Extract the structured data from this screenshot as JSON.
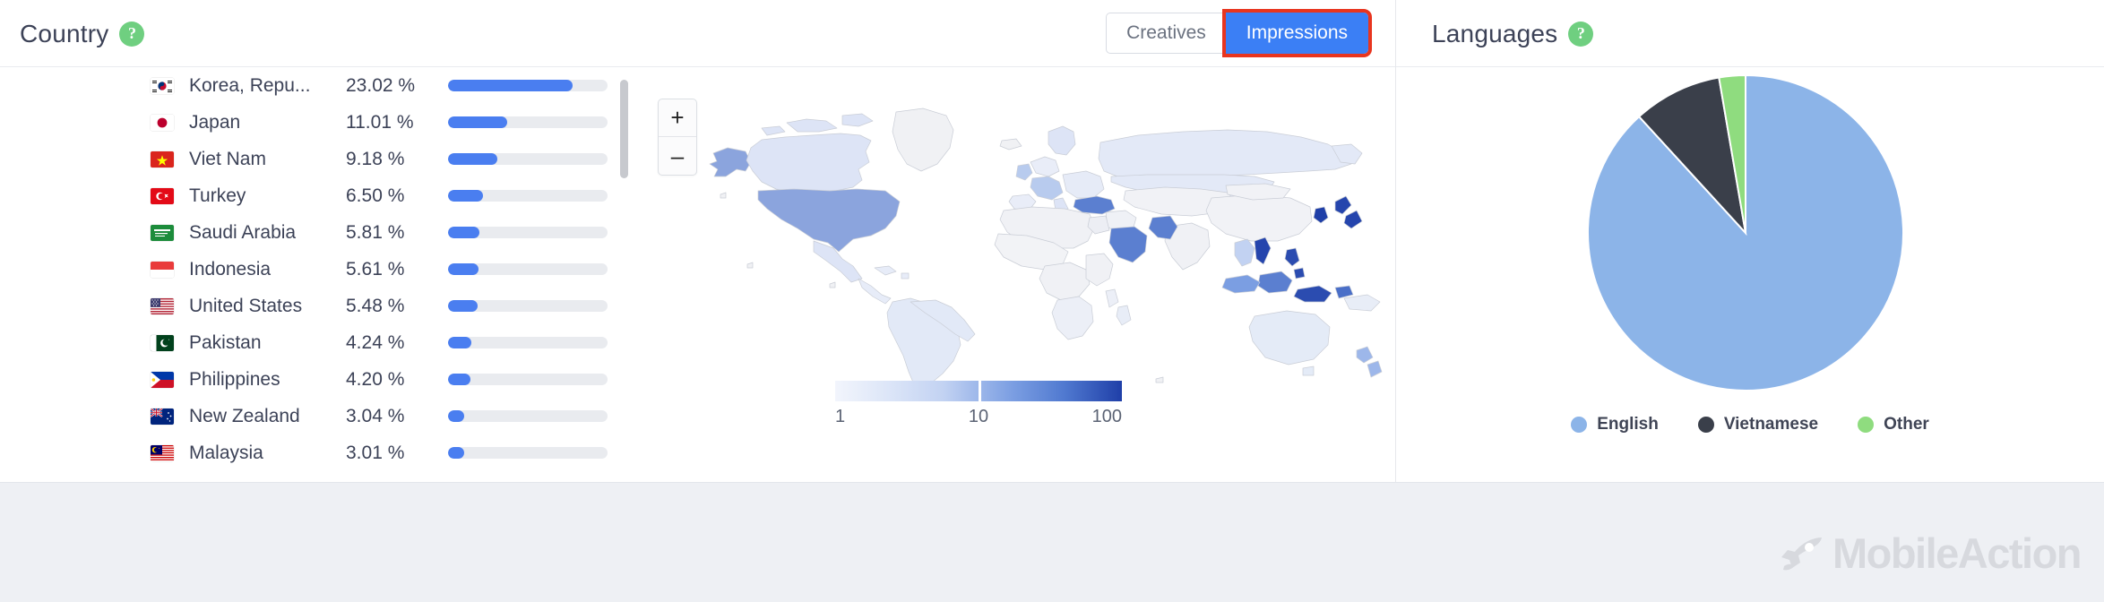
{
  "country_panel": {
    "title": "Country",
    "help_icon": "question-mark-icon",
    "help_label": "?",
    "toggle": {
      "options": [
        {
          "label": "Creatives",
          "active": false
        },
        {
          "label": "Impressions",
          "active": true
        }
      ],
      "selected": "Impressions",
      "active_color": "#3b7ff5",
      "highlight_color": "#e8351f"
    },
    "rows": [
      {
        "country": "Korea, Repu...",
        "percent": "23.02 %",
        "value": 23.02,
        "flag": "flag-kr"
      },
      {
        "country": "Japan",
        "percent": "11.01 %",
        "value": 11.01,
        "flag": "flag-jp"
      },
      {
        "country": "Viet Nam",
        "percent": "9.18 %",
        "value": 9.18,
        "flag": "flag-vn"
      },
      {
        "country": "Turkey",
        "percent": "6.50 %",
        "value": 6.5,
        "flag": "flag-tr"
      },
      {
        "country": "Saudi Arabia",
        "percent": "5.81 %",
        "value": 5.81,
        "flag": "flag-sa"
      },
      {
        "country": "Indonesia",
        "percent": "5.61 %",
        "value": 5.61,
        "flag": "flag-id"
      },
      {
        "country": "United States",
        "percent": "5.48 %",
        "value": 5.48,
        "flag": "flag-us"
      },
      {
        "country": "Pakistan",
        "percent": "4.24 %",
        "value": 4.24,
        "flag": "flag-pk"
      },
      {
        "country": "Philippines",
        "percent": "4.20 %",
        "value": 4.2,
        "flag": "flag-ph"
      },
      {
        "country": "New Zealand",
        "percent": "3.04 %",
        "value": 3.04,
        "flag": "flag-nz"
      },
      {
        "country": "Malaysia",
        "percent": "3.01 %",
        "value": 3.01,
        "flag": "flag-my"
      }
    ],
    "map": {
      "zoom_in_label": "+",
      "zoom_out_label": "–",
      "legend_ticks": [
        "1",
        "10",
        "100"
      ],
      "scale_low_color": "#f2f5fc",
      "scale_high_color": "#1f3fa8"
    }
  },
  "languages_panel": {
    "title": "Languages",
    "help_label": "?"
  },
  "chart_data": {
    "type": "pie",
    "title": "Languages",
    "labels": [
      "English",
      "Vietnamese",
      "Other"
    ],
    "values": [
      88.2,
      9.1,
      2.7
    ],
    "colors": [
      "#8cb4e8",
      "#3a3f4a",
      "#8fdc7f"
    ],
    "legend_position": "bottom",
    "grid": false
  },
  "footer": {
    "brand": "MobileAction",
    "brand_icon": "rocket-icon",
    "brand_color": "#d7d9de"
  }
}
